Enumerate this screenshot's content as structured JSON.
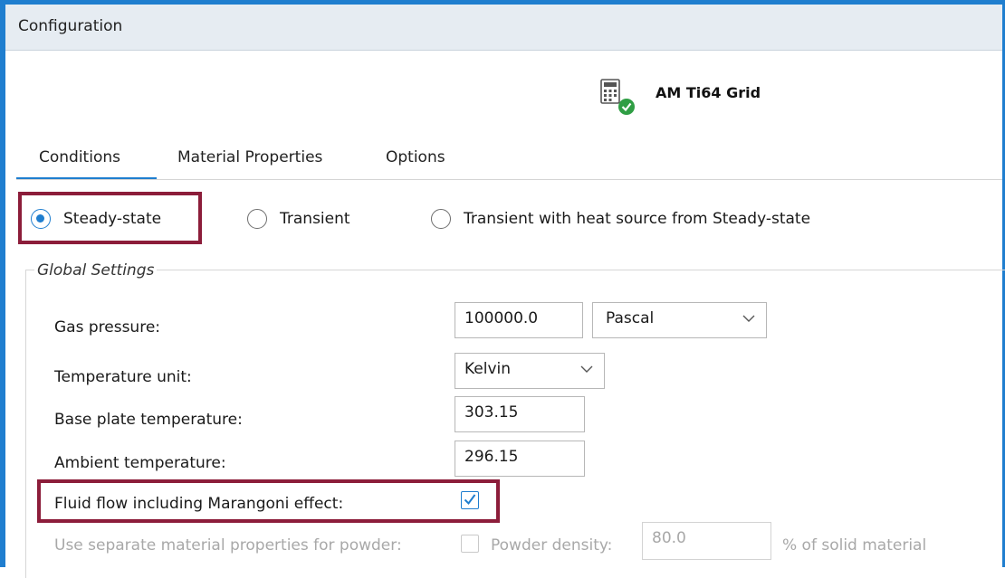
{
  "window": {
    "title": "Configuration"
  },
  "header": {
    "name": "AM Ti64 Grid",
    "icon": "calculator-check-icon"
  },
  "tabs": [
    {
      "label": "Conditions",
      "active": true
    },
    {
      "label": "Material Properties",
      "active": false
    },
    {
      "label": "Options",
      "active": false
    }
  ],
  "mode": {
    "options": [
      "Steady-state",
      "Transient",
      "Transient with heat source from Steady-state"
    ],
    "selected": "Steady-state"
  },
  "global_settings": {
    "title": "Global Settings",
    "gas_pressure": {
      "label": "Gas pressure:",
      "value": "100000.0",
      "unit": "Pascal"
    },
    "temperature_unit": {
      "label": "Temperature unit:",
      "value": "Kelvin"
    },
    "base_plate_temperature": {
      "label": "Base plate temperature:",
      "value": "303.15"
    },
    "ambient_temperature": {
      "label": "Ambient temperature:",
      "value": "296.15"
    },
    "fluid_flow": {
      "label": "Fluid flow including Marangoni effect:",
      "checked": true
    },
    "separate_powder": {
      "label": "Use separate material properties for powder:",
      "checked": false
    },
    "powder_density": {
      "label": "Powder density:",
      "value": "80.0",
      "unit": "% of solid material"
    }
  },
  "colors": {
    "accent": "#1f7ecf",
    "highlight": "#8c1d3a",
    "titlebar": "#e6ecf2"
  }
}
